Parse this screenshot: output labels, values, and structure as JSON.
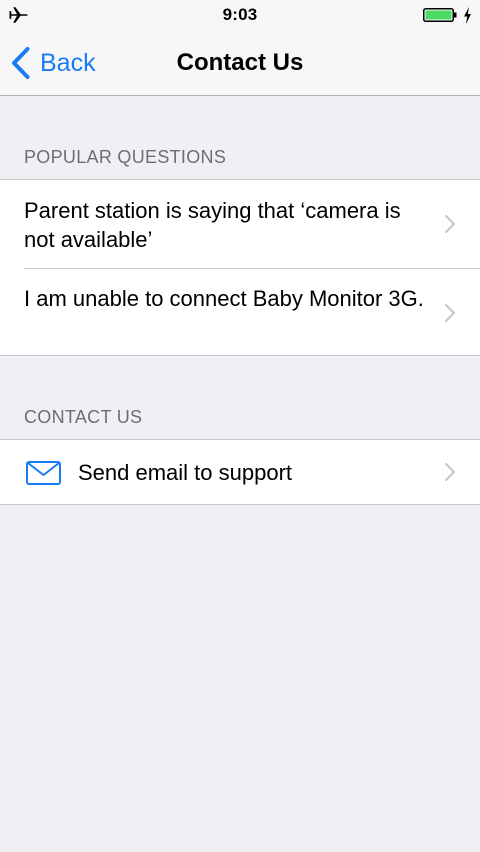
{
  "status_bar": {
    "time": "9:03",
    "airplane_icon": "airplane-icon",
    "battery_icon": "battery-charging-icon"
  },
  "nav": {
    "back_label": "Back",
    "title": "Contact Us",
    "accent": "#1a7cf2"
  },
  "sections": {
    "popular": {
      "header": "POPULAR QUESTIONS",
      "items": [
        {
          "text": "Parent station is saying that ‘camera is not available’"
        },
        {
          "text": "I am unable to connect Baby Monitor 3G."
        }
      ]
    },
    "contact": {
      "header": "CONTACT US",
      "items": [
        {
          "text": "Send email to support",
          "icon": "mail-icon"
        }
      ]
    }
  }
}
